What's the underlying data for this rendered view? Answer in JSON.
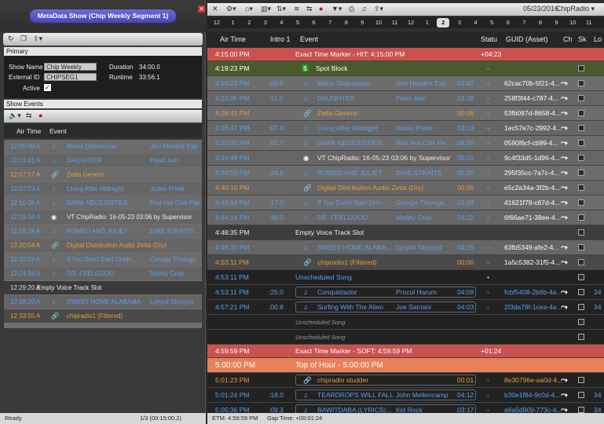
{
  "left": {
    "title": "MetaData Show (Chip Weekly Segment 1)",
    "primary_label": "Primary",
    "show_name_label": "Show Name",
    "show_name": "Chip Weekly Segme",
    "external_id_label": "External ID",
    "external_id": "CHIPSEG1",
    "active_label": "Active",
    "duration_label": "Duration",
    "duration": "34:00.0",
    "runtime_label": "Runtime",
    "runtime": "33:56.1",
    "show_events_label": "Show Events",
    "col_air_time": "Air Time",
    "col_event": "Event",
    "rows": [
      {
        "time": "12:00:00 A",
        "title": "Manic Depression",
        "artist": "Jimi Hendrix Exp",
        "kind": "song"
      },
      {
        "time": "12:03:41 A",
        "title": "DAUGHTER",
        "artist": "Pearl Jam",
        "kind": "song"
      },
      {
        "time": "12:07:17 A",
        "title": "Zetta Generic",
        "artist": "",
        "kind": "link"
      },
      {
        "time": "12:07:23 A",
        "title": "Living After Midnight",
        "artist": "Judas Priest",
        "kind": "song"
      },
      {
        "time": "12:10:36 A",
        "title": "DARK NECESSITIES",
        "artist": "Red Hot Chili Pep",
        "kind": "song"
      },
      {
        "time": "12:15:34 A",
        "title": "VT ChipRadio: 16-05-23 03:06 by Supervisor",
        "artist": "",
        "kind": "vt"
      },
      {
        "time": "12:15:34 A",
        "title": "ROMEO AND JULIET",
        "artist": "DIRE STRAITS",
        "kind": "song"
      },
      {
        "time": "12:20:54 A",
        "title": "Digital Distribution Audio Zetta (Dry)",
        "artist": "",
        "kind": "link"
      },
      {
        "time": "12:20:59 A",
        "title": "If You Don't Start Drinki...",
        "artist": "George Thorogo",
        "kind": "song"
      },
      {
        "time": "12:24:58 A",
        "title": "DR. FEELGOOD",
        "artist": "Motley Crue",
        "kind": "song"
      },
      {
        "time": "12:29:20 A",
        "title": "Empty Voice Track Slot",
        "artist": "",
        "kind": "empty"
      },
      {
        "time": "12:29:20 A",
        "title": "SWEET HOME ALABAMA",
        "artist": "Lynyrd Skynyrd",
        "kind": "song"
      },
      {
        "time": "12:33:55 A",
        "title": "chipradio1 (Filtered)",
        "artist": "",
        "kind": "link"
      }
    ],
    "status_ready": "Ready",
    "status_count": "1/3 (00:15:00.2)"
  },
  "right": {
    "date": "05/23/2016",
    "station": "ChipRadio",
    "hours": [
      "12",
      "1",
      "2",
      "3",
      "4",
      "5",
      "6",
      "7",
      "8",
      "9",
      "10",
      "11",
      "12",
      "1",
      "2",
      "3",
      "4",
      "5",
      "6",
      "7",
      "8",
      "9",
      "10",
      "11"
    ],
    "selected_hour_index": 14,
    "cols": {
      "air_time": "Air Time",
      "intro": "Intro 1",
      "event": "Event",
      "status": "Statu",
      "guid": "GUID (Asset)",
      "ch": "Ch",
      "sk": "Sk",
      "lo": "Lo"
    },
    "rows": [
      {
        "type": "marker",
        "time": "4:15:00 PM",
        "text": "Exact Time Marker - HIT: 4:15:00 PM",
        "extra": "+04:23"
      },
      {
        "type": "spot",
        "time": "4:19:23 PM",
        "text": "Spot Block",
        "status": "-"
      },
      {
        "type": "song",
        "time": "4:19:23 PM",
        "intro": ":09.0",
        "title": "Manic Depression",
        "artist": "Jimi Hendrix Exp...",
        "len": "03:42",
        "guid": "62cac70b-5f21-4..."
      },
      {
        "type": "song",
        "time": "4:23:05 PM",
        "intro": ":11.0",
        "title": "DAUGHTER",
        "artist": "Pearl Jam",
        "len": "03:36",
        "guid": "258f3f44-c787-4..."
      },
      {
        "type": "link",
        "time": "4:26:41 PM",
        "intro": "",
        "title": "Zetta Generic",
        "artist": "",
        "len": "00:06",
        "guid": "53fb087d-8658-4..."
      },
      {
        "type": "song",
        "time": "4:26:47 PM",
        "intro": ":07.3",
        "title": "Living After Midnight",
        "artist": "Judas Priest",
        "len": "03:13",
        "guid": "1ec57e7c-2992-4..."
      },
      {
        "type": "song",
        "time": "4:30:00 PM",
        "intro": ":52.7",
        "title": "DARK NECESSITIES",
        "artist": "Red Hot Chili Pe...",
        "len": "04:50",
        "guid": "0590f6cf-cb99-4..."
      },
      {
        "type": "vt",
        "time": "4:34:49 PM",
        "intro": "",
        "title": "VT ChipRadio: 16-05-23 03:06 by Supervisor",
        "artist": "",
        "len": "00:01",
        "guid": "9c4f33d5-1d96-4..."
      },
      {
        "type": "song",
        "time": "4:34:50 PM",
        "intro": ":24.0",
        "title": "ROMEO AND JULIET",
        "artist": "DIRE STRAITS",
        "len": "05:20",
        "guid": "295f35cc-7a7c-4..."
      },
      {
        "type": "link",
        "time": "4:40:10 PM",
        "intro": "",
        "title": "Digital Distribution Audio Zetta (Dry)",
        "artist": "",
        "len": "00:05",
        "guid": "e5c2a34a-3f2b-4..."
      },
      {
        "type": "song",
        "time": "4:40:14 PM",
        "intro": ":17.0",
        "title": "If You Don't Start Drin...",
        "artist": "George Thorogo...",
        "len": "03:59",
        "guid": "41621f79-c67d-4..."
      },
      {
        "type": "song",
        "time": "4:44:14 PM",
        "intro": ":48.0",
        "title": "DR. FEELGOOD",
        "artist": "Motley Crue",
        "len": "04:22",
        "guid": "6f66ae71-38ee-4..."
      },
      {
        "type": "empty",
        "time": "4:48:35 PM",
        "text": "Empty Voice Track Slot"
      },
      {
        "type": "song",
        "time": "4:48:35 PM",
        "intro": "",
        "title": "SWEET HOME ALABA...",
        "artist": "Lynyrd Skynyrd",
        "len": "04:35",
        "guid": "63fb5349-afe2-4..."
      },
      {
        "type": "link",
        "time": "4:53:11 PM",
        "intro": "",
        "title": "chipradio1 (Filtered)",
        "artist": "",
        "len": "00:00",
        "guid": "1a5c5382-31f5-4..."
      },
      {
        "type": "unsched",
        "time": "4:53:11 PM",
        "text": "Unscheduled Song",
        "status": "•"
      },
      {
        "type": "dark",
        "time": "4:53:11 PM",
        "intro": ":25.0",
        "title": "Conquistador",
        "artist": "Procol Harum",
        "len": "04:09",
        "guid": "fcbf5408-2b6b-4a...",
        "lo": "34"
      },
      {
        "type": "dark",
        "time": "4:57:21 PM",
        "intro": ":00.8",
        "title": "Surfing With The Alien",
        "artist": "Joe Satriani",
        "len": "04:03",
        "guid": "2f3da79f-1cea-4a...",
        "lo": "34"
      },
      {
        "type": "ghost",
        "text": "Unscheduled Song"
      },
      {
        "type": "ghost",
        "text": "Unscheduled Song"
      },
      {
        "type": "marker",
        "time": "4:59:59 PM",
        "text": "Exact Time Marker - SOFT: 4:59:59 PM",
        "extra": "+01:24"
      },
      {
        "type": "tophour",
        "time": "5:00:00 PM",
        "text": "Top of Hour - 5:00:00 PM"
      },
      {
        "type": "darklink",
        "time": "5:01:23 PM",
        "intro": "",
        "title": "chipradio studder",
        "artist": "",
        "len": "00:01",
        "guid": "8e30796e-aa0d-4..."
      },
      {
        "type": "dark",
        "time": "5:01:24 PM",
        "intro": ":18.0",
        "title": "TEARDROPS WILL FALL",
        "artist": "John Mellencamp",
        "len": "04:12",
        "guid": "b30e1f84-9c0d-4...",
        "lo": "34"
      },
      {
        "type": "dark",
        "time": "5:05:36 PM",
        "intro": ":09.3",
        "title": "BAWITDABA (LYRICS)...",
        "artist": "Kid Rock",
        "len": "03:17",
        "guid": "a6a5d909-773c-4...",
        "lo": "34"
      }
    ],
    "status_etm": "ETM:  4:59:59 PM",
    "status_gap": "Gap Time:  +00:01:24"
  },
  "colors": {
    "marker": "#c9524e",
    "spot": "#4b5a2c",
    "played": "#6a6a6a",
    "link_orange": "#e89a3a",
    "song_blue": "#5aa0e8",
    "tophour": "#e8805a"
  }
}
